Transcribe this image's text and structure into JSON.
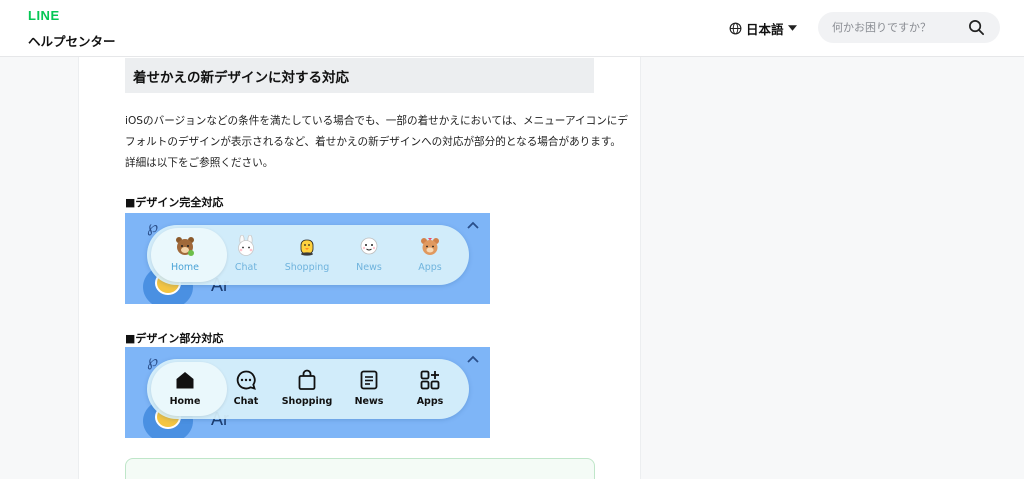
{
  "header": {
    "brand": "LINE",
    "site_title": "ヘルプセンター",
    "language": "日本語",
    "search_placeholder": "何かお困りですか？"
  },
  "article": {
    "section_heading": "着せかえの新デザインに対する対応",
    "paragraph_lines": [
      "iOSのバージョンなどの条件を満たしている場合でも、一部の着せかえにおいては、メニューアイコンにデ",
      "フォルトのデザインが表示されるなど、着せかえの新デザインへの対応が部分的となる場合があります。",
      "詳細は以下をご参照ください。"
    ],
    "full_support_heading": "■デザイン完全対応",
    "partial_support_heading": "■デザイン部分対応"
  },
  "screenshot_full": {
    "deco_text": "Ar",
    "tabs": [
      "Home",
      "Chat",
      "Shopping",
      "News",
      "Apps"
    ]
  },
  "screenshot_partial": {
    "deco_text": "Ar",
    "tabs": [
      "Home",
      "Chat",
      "Shopping",
      "News",
      "Apps"
    ]
  },
  "icons": {
    "globe": "globe-icon",
    "dropdown": "caret-down-icon",
    "search": "search-icon",
    "chevron": "chevron-up-icon",
    "full_tab_icons": [
      "brown-bear-icon",
      "cony-rabbit-icon",
      "sally-chick-icon",
      "moon-icon",
      "choco-bear-icon"
    ],
    "partial_tab_icons": [
      "house-icon",
      "chat-bubble-icon",
      "shopping-bag-icon",
      "news-icon",
      "apps-grid-icon"
    ]
  },
  "colors": {
    "brand_green": "#06c755",
    "screenshot_bg": "#7eb5f7",
    "tab_label_full": "#6fb3dd"
  }
}
